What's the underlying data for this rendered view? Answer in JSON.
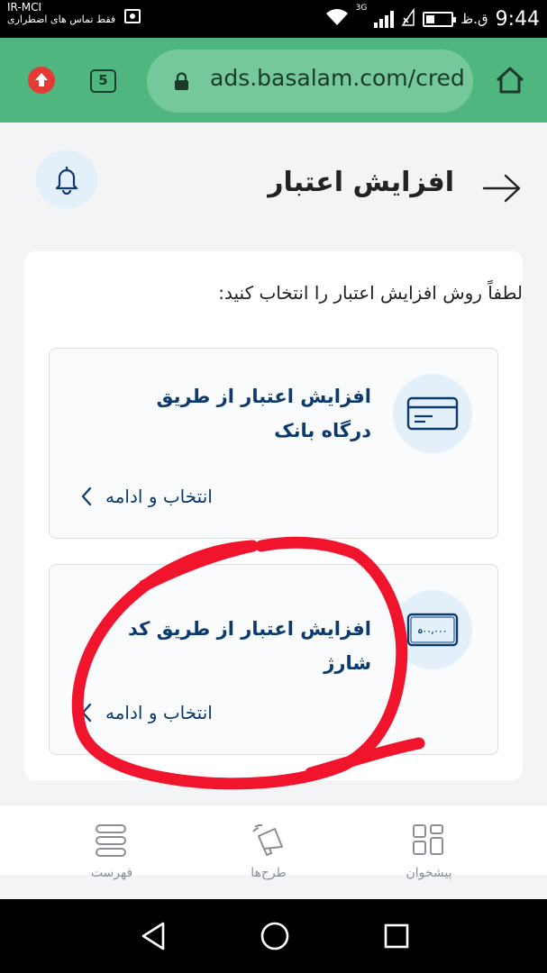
{
  "status_bar": {
    "carrier": "IR-MCI",
    "carrier_subtitle": "فقط تماس های اضطراری",
    "network_type": "3G",
    "time": "9:44",
    "ampm": "ق.ظ"
  },
  "browser": {
    "url": "ads.basalam.com/cred",
    "tab_count": "5",
    "icons": [
      "update-icon",
      "tabs-icon",
      "lock-icon",
      "home-icon"
    ]
  },
  "header": {
    "title": "افزایش اعتبار",
    "icons": [
      "bell-icon",
      "back-arrow-icon"
    ]
  },
  "card": {
    "instruction": "لطفاً روش افزایش اعتبار را انتخاب کنید:",
    "options": [
      {
        "title": "افزایش اعتبار از طریق درگاه بانک",
        "action": "انتخاب و ادامه",
        "icon": "bank-card-icon"
      },
      {
        "title": "افزایش اعتبار از طریق کد شارژ",
        "action": "انتخاب و ادامه",
        "icon": "charge-code-icon",
        "icon_text": "۵۰۰,۰۰۰"
      }
    ]
  },
  "bottom_nav": {
    "items": [
      {
        "label": "فهرست",
        "icon": "menu-icon"
      },
      {
        "label": "طرح‌ها",
        "icon": "megaphone-icon"
      },
      {
        "label": "پیشخوان",
        "icon": "dashboard-icon"
      }
    ]
  },
  "colors": {
    "browser_bar": "#50b680",
    "url_pill": "#75c89c",
    "primary_text": "#0b3a6e",
    "icon_circle": "#e3f0fa",
    "annotation": "#f0142d"
  }
}
